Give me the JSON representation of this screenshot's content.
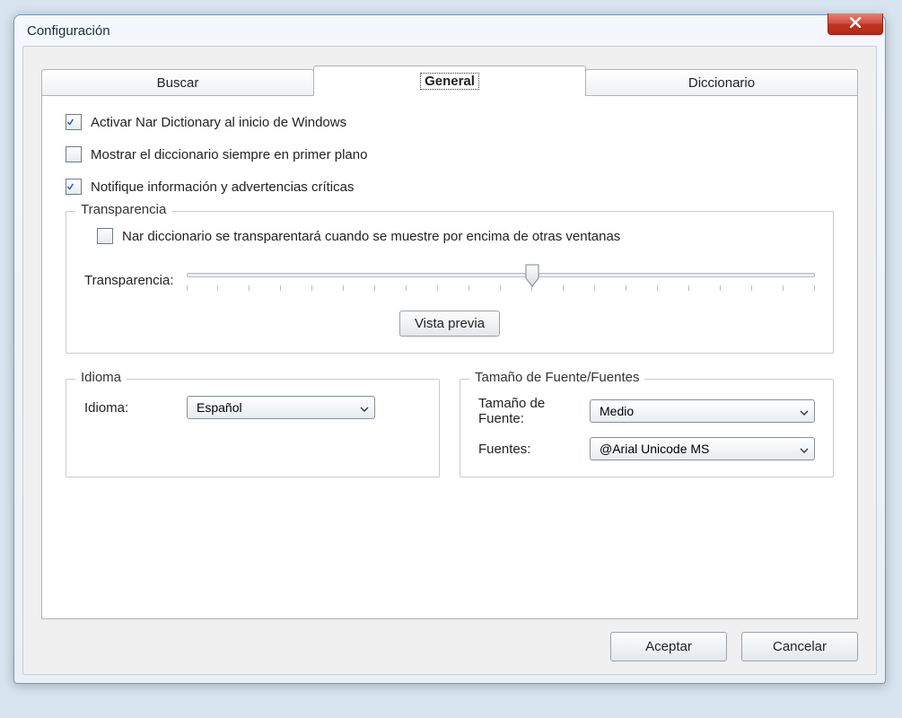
{
  "window": {
    "title": "Configuración"
  },
  "tabs": {
    "search": "Buscar",
    "general": "General",
    "dictionary": "Diccionario"
  },
  "checkboxes": {
    "activate_on_startup": {
      "label": "Activar Nar Dictionary al inicio de Windows",
      "checked": true
    },
    "always_on_top": {
      "label": "Mostrar el diccionario siempre en primer plano",
      "checked": false
    },
    "notify_critical": {
      "label": "Notifique información y advertencias críticas",
      "checked": true
    }
  },
  "transparency": {
    "group_title": "Transparencia",
    "enable": {
      "label": "Nar diccionario se transparentará cuando se muestre por encima de otras ventanas",
      "checked": false
    },
    "slider_label": "Transparencia:",
    "slider_percent": 55,
    "preview_button": "Vista previa"
  },
  "language": {
    "group_title": "Idioma",
    "label": "Idioma:",
    "value": "Español"
  },
  "fonts": {
    "group_title": "Tamaño de Fuente/Fuentes",
    "size_label": "Tamaño de Fuente:",
    "size_value": "Medio",
    "font_label": "Fuentes:",
    "font_value": "@Arial Unicode MS"
  },
  "buttons": {
    "accept": "Aceptar",
    "cancel": "Cancelar"
  }
}
